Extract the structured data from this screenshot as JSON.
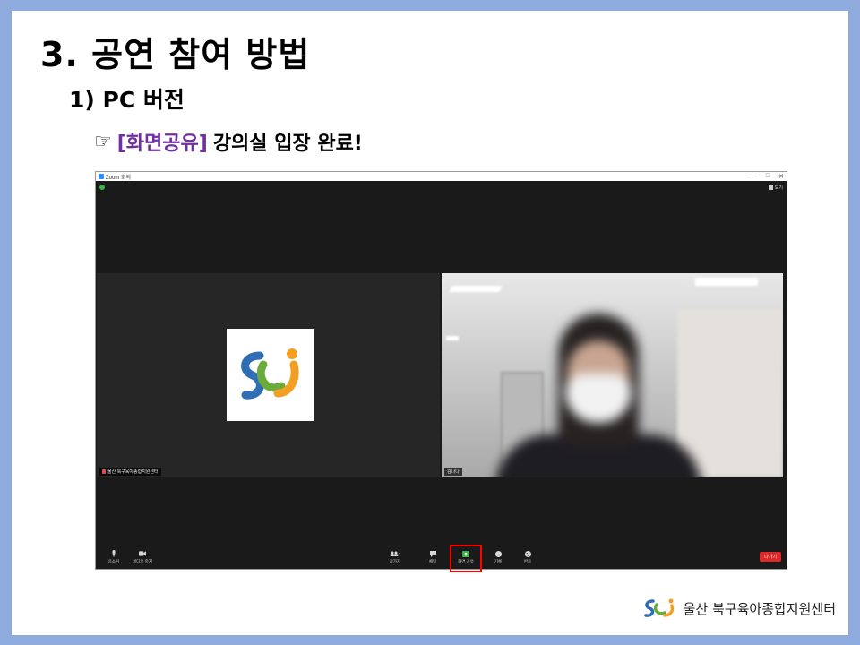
{
  "slide": {
    "title": "3. 공연 참여 방법",
    "subtitle": "1) PC 버전",
    "step": {
      "hand": "☞",
      "highlight": "[화면공유]",
      "text": "강의실 입장 완료!"
    }
  },
  "zoom": {
    "window_title": "Zoom 회의",
    "window_controls": [
      "—",
      "□",
      "✕"
    ],
    "view_button": "보기",
    "left_tile_name": "울산 북구육아종합지원센터",
    "right_tile_name": "김나나",
    "toolbar": {
      "mute": "음소거",
      "video": "비디오 중지",
      "participants": "참가자",
      "participants_count": "2",
      "chat": "채팅",
      "share": "화면 공유",
      "record": "기록",
      "reactions": "반응",
      "leave": "나가기"
    },
    "colors": {
      "share_icon": "#3db34a",
      "leave_button": "#e02828",
      "highlight_box": "#ff0000"
    }
  },
  "footer": {
    "brand_name": "울산 북구육아종합지원센터"
  },
  "colors": {
    "frame": "#8faadc",
    "highlight_text": "#7030a0"
  }
}
